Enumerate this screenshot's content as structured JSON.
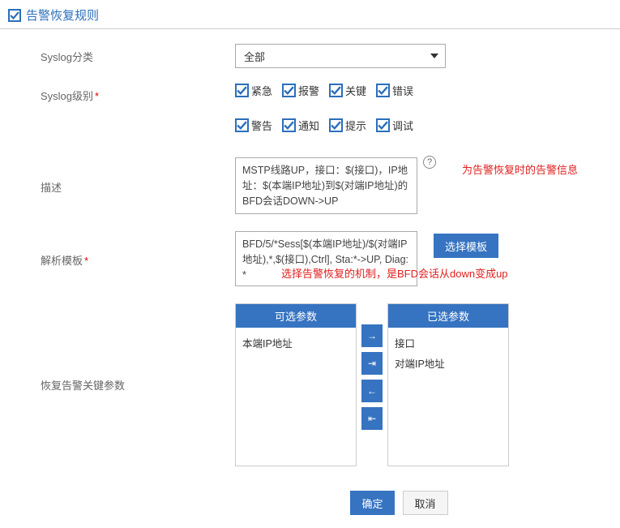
{
  "header": {
    "title": "告警恢复规则"
  },
  "labels": {
    "syslog_category": "Syslog分类",
    "syslog_level": "Syslog级别",
    "description": "描述",
    "parse_template": "解析模板",
    "recovery_key_params": "恢复告警关键参数",
    "required_mark": "*"
  },
  "syslog_category": {
    "selected": "全部"
  },
  "levels": [
    {
      "label": "紧急",
      "checked": true
    },
    {
      "label": "报警",
      "checked": true
    },
    {
      "label": "关键",
      "checked": true
    },
    {
      "label": "错误",
      "checked": true
    },
    {
      "label": "警告",
      "checked": true
    },
    {
      "label": "通知",
      "checked": true
    },
    {
      "label": "提示",
      "checked": true
    },
    {
      "label": "调试",
      "checked": true
    }
  ],
  "description_value": "MSTP线路UP，接口：$(接口)，IP地址：$(本端IP地址)到$(对端IP地址)的BFD会话DOWN->UP",
  "annotations": {
    "desc": "为告警恢复时的告警信息",
    "tpl": "选择告警恢复的机制，是BFD会话从down变成up"
  },
  "template_value": "BFD/5/*Sess[$(本端IP地址)/$(对端IP地址),*,$(接口),Ctrl], Sta:*->UP, Diag: *",
  "buttons": {
    "select_template": "选择模板",
    "ok": "确定",
    "cancel": "取消"
  },
  "transfer": {
    "available_head": "可选参数",
    "selected_head": "已选参数",
    "available": [
      "本端IP地址"
    ],
    "selected": [
      "接口",
      "对端IP地址"
    ],
    "btn_right": "→",
    "btn_right_all": "⇥",
    "btn_left": "←",
    "btn_left_all": "⇤"
  },
  "help_tooltip": "?"
}
